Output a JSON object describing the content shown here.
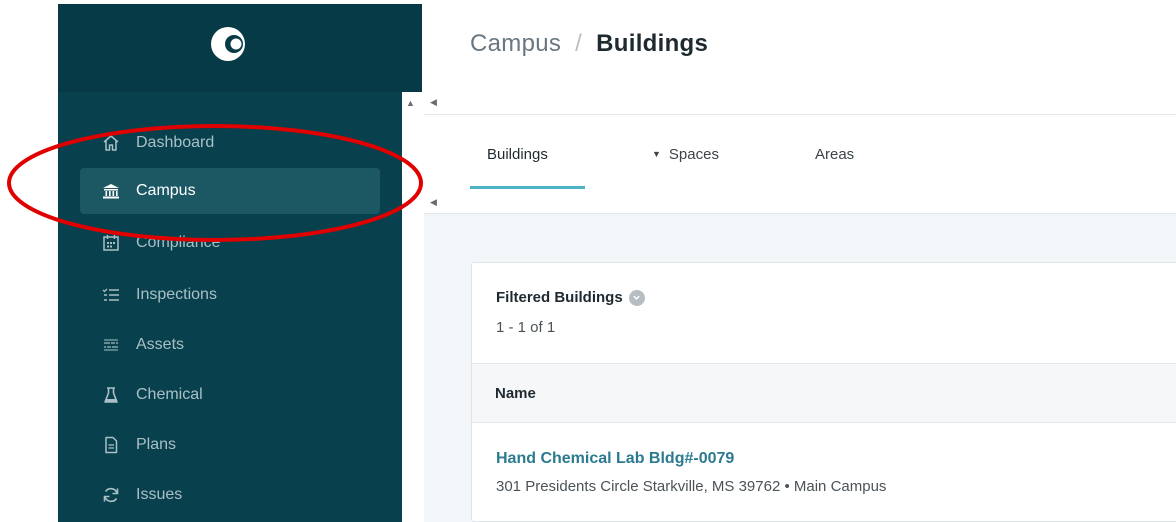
{
  "sidebar": {
    "items": [
      {
        "label": "Dashboard",
        "icon": "home-icon"
      },
      {
        "label": "Campus",
        "icon": "building-columns-icon"
      },
      {
        "label": "Compliance",
        "icon": "calendar-icon"
      },
      {
        "label": "Inspections",
        "icon": "checklist-icon"
      },
      {
        "label": "Assets",
        "icon": "barcode-icon"
      },
      {
        "label": "Chemical",
        "icon": "flask-icon"
      },
      {
        "label": "Plans",
        "icon": "document-icon"
      },
      {
        "label": "Issues",
        "icon": "refresh-icon"
      }
    ],
    "active": "Campus"
  },
  "header": {
    "breadcrumb_parent": "Campus",
    "breadcrumb_separator": "/",
    "breadcrumb_current": "Buildings"
  },
  "tabs": [
    {
      "label": "Buildings"
    },
    {
      "label": "Spaces"
    },
    {
      "label": "Areas"
    }
  ],
  "card": {
    "title": "Filtered Buildings",
    "count": "1 - 1 of 1",
    "column_name": "Name",
    "rows": [
      {
        "name": "Hand Chemical Lab Bldg#-0079",
        "address": "301 Presidents Circle Starkville, MS 39762 • Main Campus"
      }
    ]
  },
  "colors": {
    "sidebar": "#08404d",
    "active_item": "#1b5864",
    "accent": "#4fb3c7",
    "link": "#2b7a8f",
    "annotation": "#e00000"
  }
}
